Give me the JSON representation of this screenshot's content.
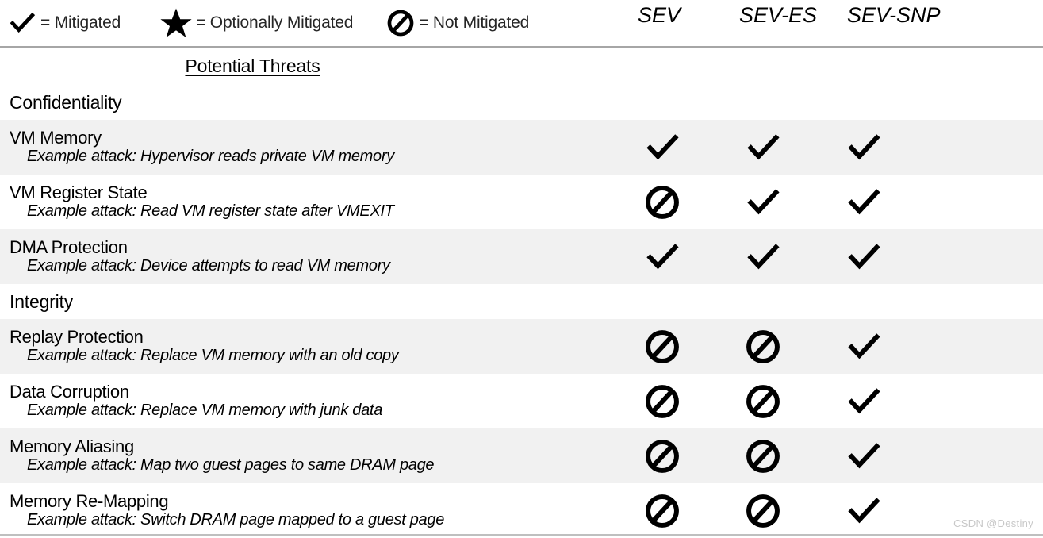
{
  "legend": {
    "items": [
      {
        "icon": "check-icon",
        "symbol": "check",
        "label": "= Mitigated"
      },
      {
        "icon": "star-icon",
        "symbol": "star",
        "label": "= Optionally Mitigated"
      },
      {
        "icon": "no-entry-icon",
        "symbol": "blocked",
        "label": "= Not Mitigated"
      }
    ]
  },
  "columns": [
    {
      "label": "SEV"
    },
    {
      "label": "SEV-ES"
    },
    {
      "label": "SEV-SNP"
    }
  ],
  "table": {
    "threats_header": "Potential Threats",
    "rows": [
      {
        "kind": "header",
        "label": "Potential Threats",
        "shaded": false,
        "marks": []
      },
      {
        "kind": "section",
        "label": "Confidentiality",
        "shaded": false,
        "marks": []
      },
      {
        "kind": "data",
        "shaded": true,
        "name": "VM Memory",
        "example": "Example attack: Hypervisor reads private VM memory",
        "marks": [
          "check",
          "check",
          "check"
        ]
      },
      {
        "kind": "data",
        "shaded": false,
        "name": "VM Register State",
        "example": "Example attack: Read VM register state after VMEXIT",
        "marks": [
          "blocked",
          "check",
          "check"
        ]
      },
      {
        "kind": "data",
        "shaded": true,
        "name": "DMA Protection",
        "example": "Example attack: Device attempts to read VM memory",
        "marks": [
          "check",
          "check",
          "check"
        ]
      },
      {
        "kind": "section",
        "label": "Integrity",
        "shaded": false,
        "marks": []
      },
      {
        "kind": "data",
        "shaded": true,
        "name": "Replay Protection",
        "example": "Example attack: Replace VM memory with an old copy",
        "marks": [
          "blocked",
          "blocked",
          "check"
        ]
      },
      {
        "kind": "data",
        "shaded": false,
        "name": "Data Corruption",
        "example": "Example attack: Replace VM memory with junk data",
        "marks": [
          "blocked",
          "blocked",
          "check"
        ]
      },
      {
        "kind": "data",
        "shaded": true,
        "name": "Memory Aliasing",
        "example": "Example attack: Map two guest pages to same DRAM page",
        "marks": [
          "blocked",
          "blocked",
          "check"
        ]
      },
      {
        "kind": "data",
        "shaded": false,
        "name": "Memory Re-Mapping",
        "example": "Example attack: Switch DRAM page mapped to a guest page",
        "marks": [
          "blocked",
          "blocked",
          "check"
        ]
      }
    ]
  },
  "watermark": "CSDN @Destiny",
  "colors": {
    "stripe": "#f1f1f1",
    "border": "#a6a6a6",
    "text": "#000000",
    "legend_text": "#262626",
    "watermark": "#c8c8c8"
  }
}
